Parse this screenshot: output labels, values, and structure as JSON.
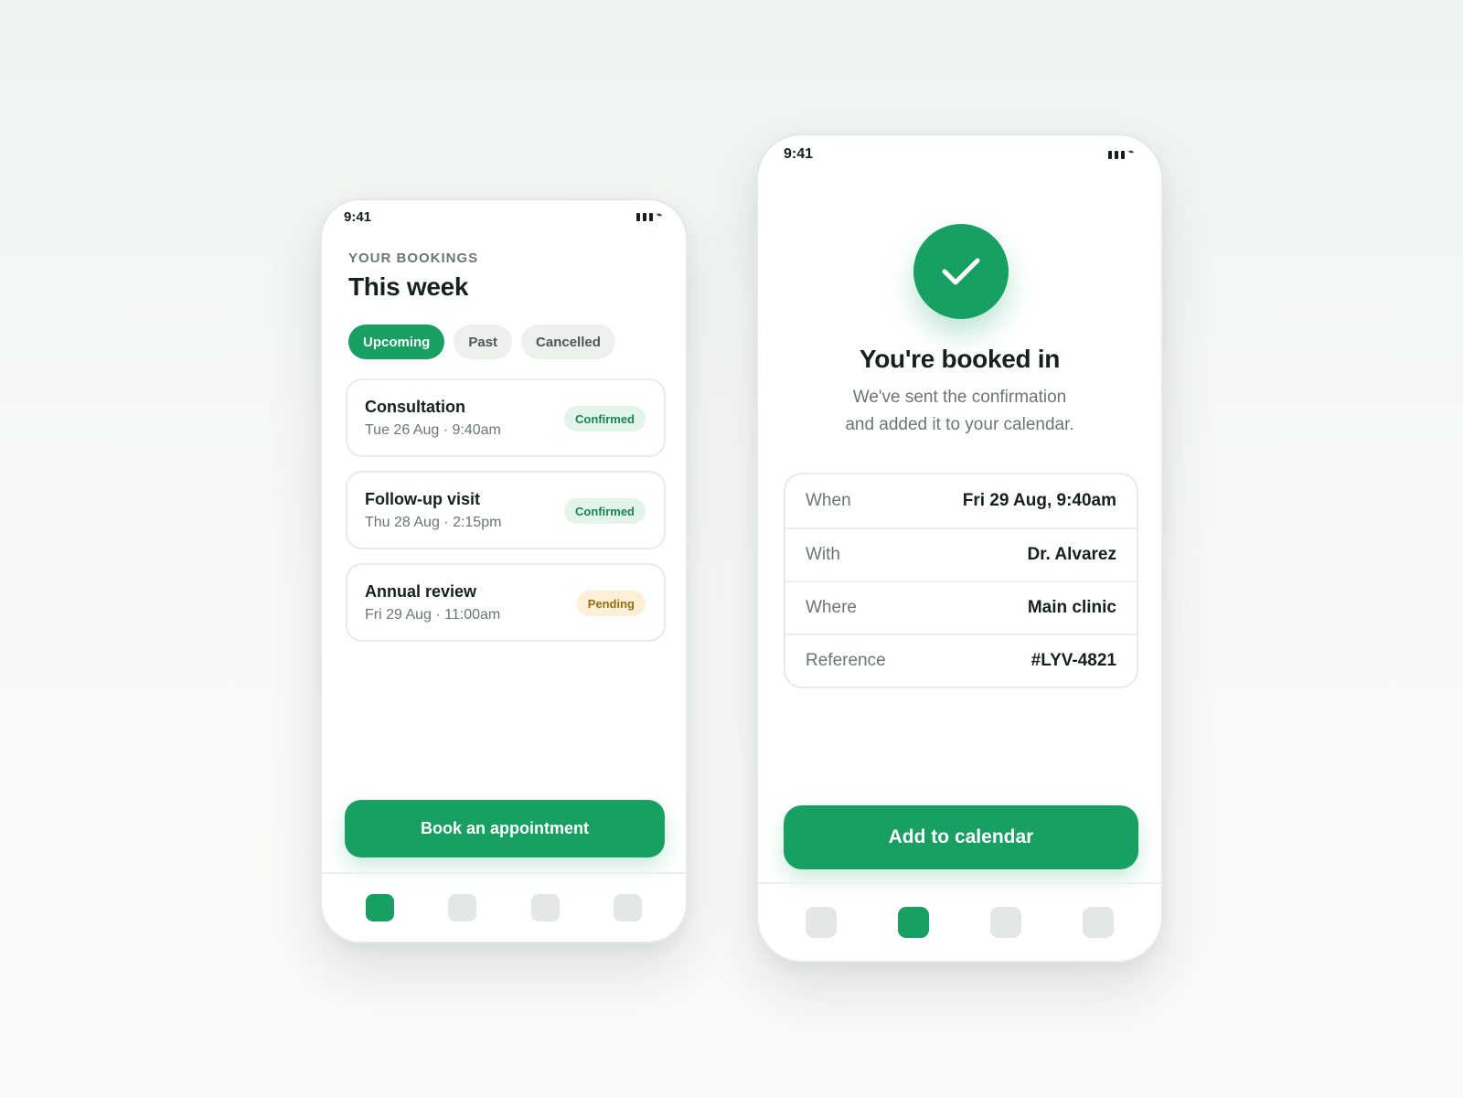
{
  "bookings_screen": {
    "status_time": "9:41",
    "eyebrow": "YOUR BOOKINGS",
    "title": "This week",
    "tabs": [
      {
        "label": "Upcoming",
        "active": true
      },
      {
        "label": "Past",
        "active": false
      },
      {
        "label": "Cancelled",
        "active": false
      }
    ],
    "bookings": [
      {
        "title": "Consultation",
        "date": "Tue 26 Aug · 9:40am",
        "status": "Confirmed"
      },
      {
        "title": "Follow-up visit",
        "date": "Thu 28 Aug · 2:15pm",
        "status": "Confirmed"
      },
      {
        "title": "Annual review",
        "date": "Fri 29 Aug · 11:00am",
        "status": "Pending"
      }
    ],
    "primary_button": "Book an appointment",
    "nav_active_index": 0
  },
  "confirmation_screen": {
    "status_time": "9:41",
    "title": "You're booked in",
    "subtitle_line1": "We've sent the confirmation",
    "subtitle_line2": "and added it to your calendar.",
    "details": [
      {
        "label": "When",
        "value": "Fri 29 Aug, 9:40am"
      },
      {
        "label": "With",
        "value": "Dr. Alvarez"
      },
      {
        "label": "Where",
        "value": "Main clinic"
      },
      {
        "label": "Reference",
        "value": "#LYV-4821"
      }
    ],
    "primary_button": "Add to calendar",
    "nav_active_index": 1
  },
  "colors": {
    "accent": "#17a062",
    "confirmed_bg": "#e3f4ea",
    "confirmed_text": "#15864f",
    "pending_bg": "#fcf0d6",
    "pending_text": "#9a6a13"
  },
  "icons": {
    "success": "checkmark-icon",
    "signal": "signal-icon",
    "wifi": "wifi-icon"
  }
}
